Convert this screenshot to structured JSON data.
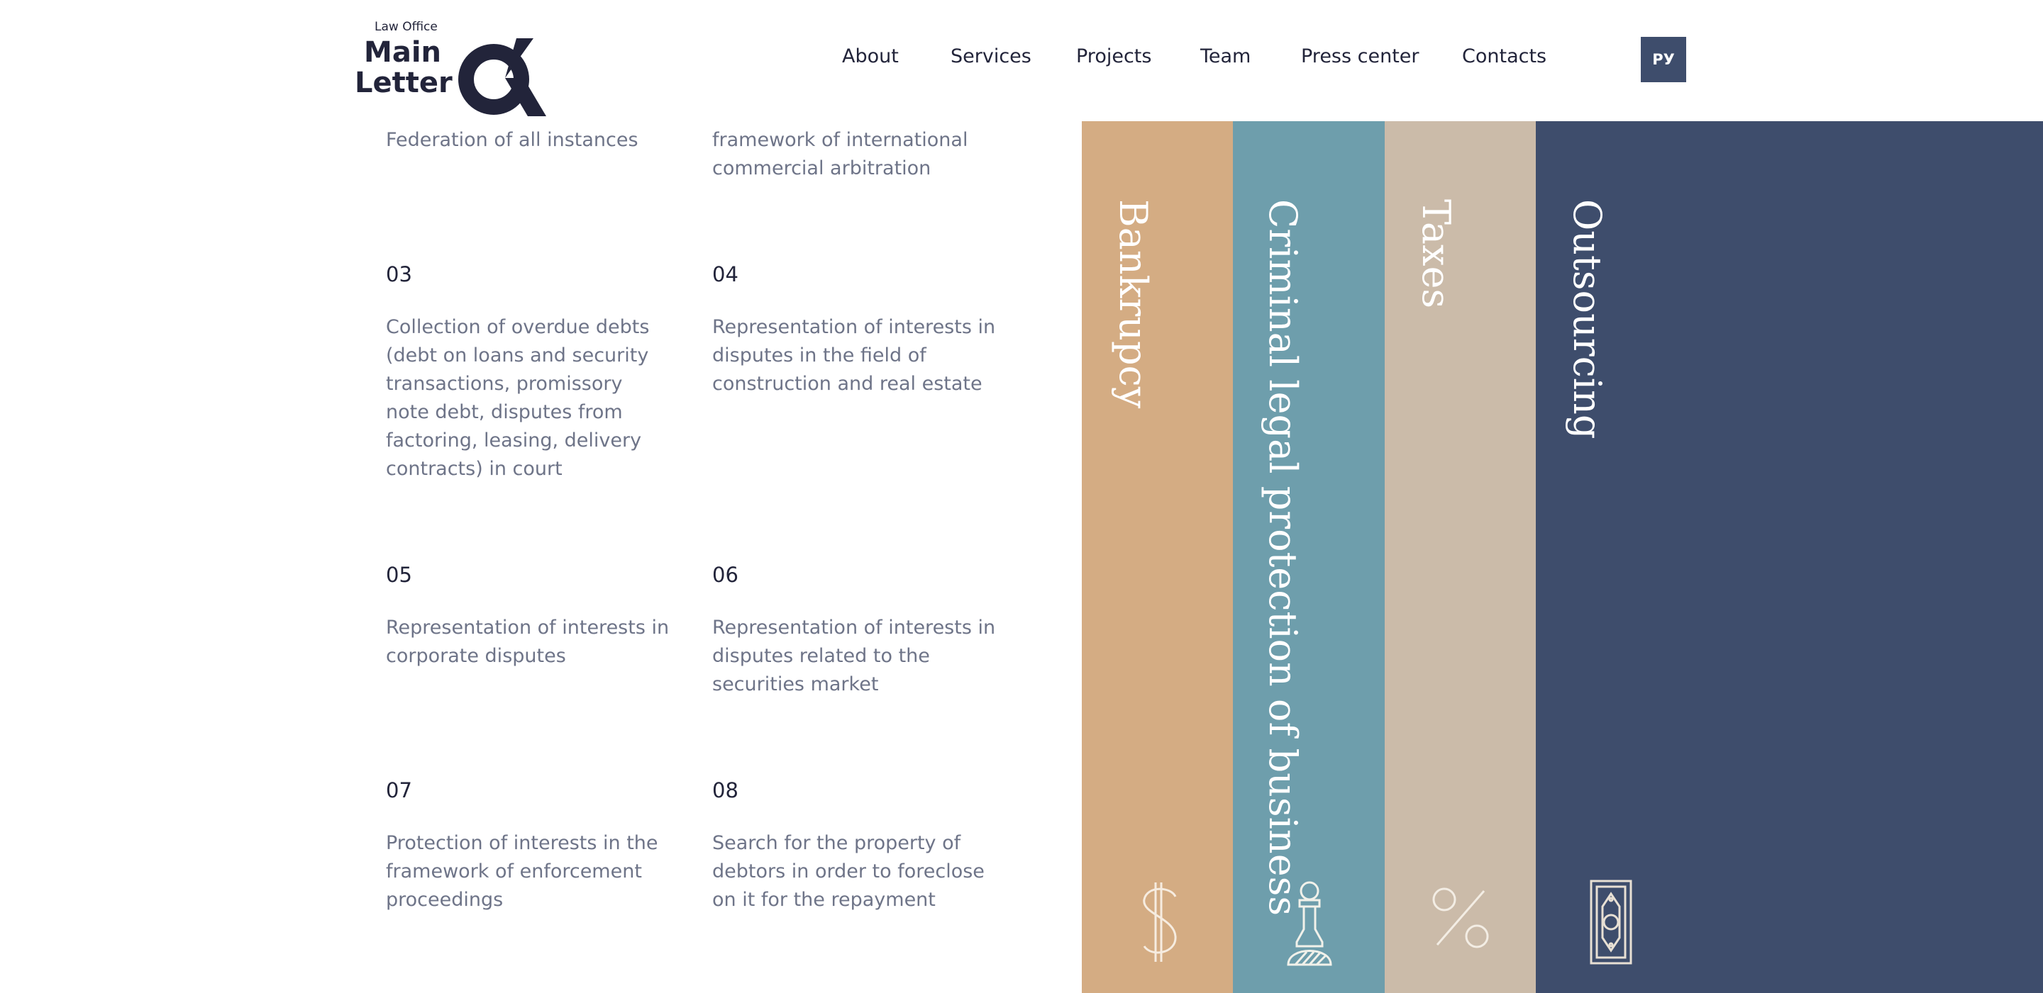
{
  "logo": {
    "subtitle": "Law Office",
    "name_line1": "Main",
    "name_line2": "Letter"
  },
  "nav": {
    "items": [
      "About",
      "Services",
      "Projects",
      "Team",
      "Press center",
      "Contacts"
    ],
    "lang_button": "РУ"
  },
  "services": {
    "items": [
      {
        "number": "",
        "text": "Federation of all instances"
      },
      {
        "number": "",
        "text": "framework of international commercial arbitration"
      },
      {
        "number": "03",
        "text": "Collection of overdue debts (debt on loans and security transactions, promissory note debt, disputes from factoring, leasing, delivery contracts) in court"
      },
      {
        "number": "04",
        "text": "Representation of interests in disputes in the field of construction and real estate"
      },
      {
        "number": "05",
        "text": "Representation of interests in corporate disputes"
      },
      {
        "number": "06",
        "text": "Representation of interests in disputes related to the securities market"
      },
      {
        "number": "07",
        "text": "Protection of interests in the framework of enforcement proceedings"
      },
      {
        "number": "08",
        "text": "Search for the property of debtors in order to foreclose on it for the repayment"
      }
    ]
  },
  "practice_areas": {
    "columns": [
      {
        "title": "Bankrupcy",
        "icon": "dollar-icon",
        "color": "#d4ac83"
      },
      {
        "title": "Criminal legal protection of business",
        "icon": "chess-piece-icon",
        "color": "#6e9eac"
      },
      {
        "title": "Taxes",
        "icon": "percent-icon",
        "color": "#cbbba9"
      },
      {
        "title": "Outsourcing",
        "icon": "banknote-icon",
        "color": "#3e4d6c"
      }
    ]
  },
  "colors": {
    "text_dark": "#22243a",
    "text_muted": "#6e7488",
    "accent_navy": "#3e4d6c"
  }
}
